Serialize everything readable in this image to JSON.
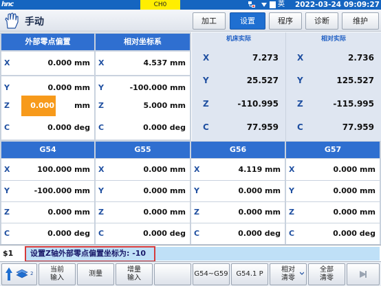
{
  "status_bar": {
    "logo": "hnc",
    "channel": "CH0",
    "language": "英",
    "datetime": "2022-03-24 09:09:27"
  },
  "header": {
    "mode": "手动",
    "tabs": [
      {
        "label": "加工",
        "active": false
      },
      {
        "label": "设置",
        "active": true
      },
      {
        "label": "程序",
        "active": false
      },
      {
        "label": "诊断",
        "active": false
      },
      {
        "label": "维护",
        "active": false
      }
    ]
  },
  "top_grid": {
    "external_offset": {
      "title": "外部零点偏置",
      "rows": [
        {
          "axis": "X",
          "value": "0.000 mm"
        },
        {
          "axis": "Y",
          "value": "0.000 mm"
        },
        {
          "axis": "Z",
          "value": "0.000",
          "unit": "mm",
          "editing": true
        },
        {
          "axis": "C",
          "value": "0.000 deg"
        }
      ]
    },
    "relative": {
      "title": "相对坐标系",
      "rows": [
        {
          "axis": "X",
          "value": "4.537 mm"
        },
        {
          "axis": "Y",
          "value": "-100.000 mm"
        },
        {
          "axis": "Z",
          "value": "5.000 mm"
        },
        {
          "axis": "C",
          "value": "0.000 deg"
        }
      ]
    },
    "machine_actual": {
      "title": "机床实际",
      "rows": [
        {
          "axis": "X",
          "value": "7.273"
        },
        {
          "axis": "Y",
          "value": "25.527"
        },
        {
          "axis": "Z",
          "value": "-110.995"
        },
        {
          "axis": "C",
          "value": "77.959"
        }
      ]
    },
    "relative_actual": {
      "title": "相对实际",
      "rows": [
        {
          "axis": "X",
          "value": "2.736"
        },
        {
          "axis": "Y",
          "value": "125.527"
        },
        {
          "axis": "Z",
          "value": "-115.995"
        },
        {
          "axis": "C",
          "value": "77.959"
        }
      ]
    }
  },
  "work_offsets": {
    "columns": [
      {
        "title": "G54",
        "rows": [
          {
            "axis": "X",
            "value": "100.000 mm"
          },
          {
            "axis": "Y",
            "value": "-100.000 mm"
          },
          {
            "axis": "Z",
            "value": "0.000 mm"
          },
          {
            "axis": "C",
            "value": "0.000 deg"
          }
        ]
      },
      {
        "title": "G55",
        "rows": [
          {
            "axis": "X",
            "value": "0.000 mm"
          },
          {
            "axis": "Y",
            "value": "0.000 mm"
          },
          {
            "axis": "Z",
            "value": "0.000 mm"
          },
          {
            "axis": "C",
            "value": "0.000 deg"
          }
        ]
      },
      {
        "title": "G56",
        "rows": [
          {
            "axis": "X",
            "value": "4.119 mm"
          },
          {
            "axis": "Y",
            "value": "0.000 mm"
          },
          {
            "axis": "Z",
            "value": "0.000 mm"
          },
          {
            "axis": "C",
            "value": "0.000 deg"
          }
        ]
      },
      {
        "title": "G57",
        "rows": [
          {
            "axis": "X",
            "value": "0.000 mm"
          },
          {
            "axis": "Y",
            "value": "0.000 mm"
          },
          {
            "axis": "Z",
            "value": "0.000 mm"
          },
          {
            "axis": "C",
            "value": "0.000 deg"
          }
        ]
      }
    ]
  },
  "message": {
    "prompt": "$1",
    "text": "设置Z轴外部零点偏置坐标为: -10"
  },
  "softkeys": {
    "level_badge": "2",
    "current_input": [
      "当前",
      "输入"
    ],
    "measure": "测量",
    "incremental_input": [
      "增量",
      "输入"
    ],
    "g54_g59": "G54~G59",
    "g54_1p": "G54.1 P",
    "relative_clear": [
      "相对",
      "清零"
    ],
    "all_clear": [
      "全部",
      "清零"
    ]
  },
  "colors": {
    "status_blue": "#1565c0",
    "header_blue": "#2f6fd0",
    "active_tab": "#1f6fd1",
    "edit_orange": "#f79a1b",
    "machine_panel": "#dfe6f1",
    "message_bg": "#bfe0f7",
    "frame_red": "#d63a3a"
  }
}
